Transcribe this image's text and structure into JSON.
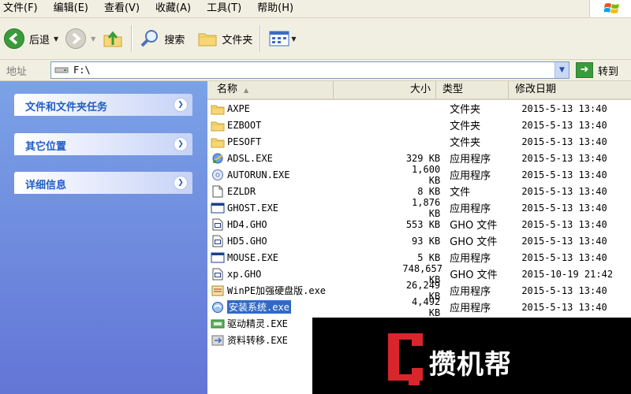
{
  "menu": [
    "文件(F)",
    "编辑(E)",
    "查看(V)",
    "收藏(A)",
    "工具(T)",
    "帮助(H)"
  ],
  "toolbar": {
    "back_label": "后退",
    "search_label": "搜索",
    "folders_label": "文件夹"
  },
  "address": {
    "label": "地址",
    "value": "F:\\",
    "go_label": "转到"
  },
  "tasks": [
    "文件和文件夹任务",
    "其它位置",
    "详细信息"
  ],
  "columns": {
    "name": "名称",
    "size": "大小",
    "type": "类型",
    "modified": "修改日期"
  },
  "files": [
    {
      "name": "AXPE",
      "size": "",
      "type": "文件夹",
      "date": "2015-5-13 13:40",
      "icon": "folder-icon"
    },
    {
      "name": "EZBOOT",
      "size": "",
      "type": "文件夹",
      "date": "2015-5-13 13:40",
      "icon": "folder-icon"
    },
    {
      "name": "PESOFT",
      "size": "",
      "type": "文件夹",
      "date": "2015-5-13 13:40",
      "icon": "folder-icon"
    },
    {
      "name": "ADSL.EXE",
      "size": "329 KB",
      "type": "应用程序",
      "date": "2015-5-13 13:40",
      "icon": "network-app-icon"
    },
    {
      "name": "AUTORUN.EXE",
      "size": "1,600 KB",
      "type": "应用程序",
      "date": "2015-5-13 13:40",
      "icon": "autorun-app-icon"
    },
    {
      "name": "EZLDR",
      "size": "8 KB",
      "type": "文件",
      "date": "2015-5-13 13:40",
      "icon": "generic-file-icon"
    },
    {
      "name": "GHOST.EXE",
      "size": "1,876 KB",
      "type": "应用程序",
      "date": "2015-5-13 13:40",
      "icon": "window-app-icon"
    },
    {
      "name": "HD4.GHO",
      "size": "553 KB",
      "type": "GHO 文件",
      "date": "2015-5-13 13:40",
      "icon": "gho-file-icon"
    },
    {
      "name": "HD5.GHO",
      "size": "93 KB",
      "type": "GHO 文件",
      "date": "2015-5-13 13:40",
      "icon": "gho-file-icon"
    },
    {
      "name": "MOUSE.EXE",
      "size": "5 KB",
      "type": "应用程序",
      "date": "2015-5-13 13:40",
      "icon": "window-app-icon"
    },
    {
      "name": "xp.GHO",
      "size": "748,657 KB",
      "type": "GHO 文件",
      "date": "2015-10-19 21:42",
      "icon": "gho-file-icon"
    },
    {
      "name": "WinPE加强硬盘版.exe",
      "size": "26,249 KB",
      "type": "应用程序",
      "date": "2015-5-13 13:40",
      "icon": "winpe-app-icon"
    },
    {
      "name": "安装系统.exe",
      "size": "4,492 KB",
      "type": "应用程序",
      "date": "2015-5-13 13:40",
      "icon": "install-app-icon",
      "selected": true
    },
    {
      "name": "驱动精灵.EXE",
      "size": "",
      "type": "",
      "date": "",
      "icon": "driver-app-icon"
    },
    {
      "name": "资料转移.EXE",
      "size": "",
      "type": "",
      "date": "",
      "icon": "transfer-app-icon"
    }
  ],
  "watermark": "攒机帮",
  "colors": {
    "xp_beige": "#f1efe2",
    "taskpane_top": "#7ba2e7",
    "taskpane_bottom": "#6375d6",
    "selection": "#316ac5",
    "watermark_red": "#d9262c"
  }
}
